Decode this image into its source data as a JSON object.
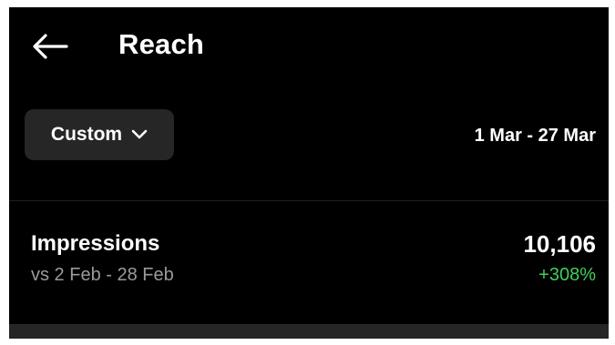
{
  "header": {
    "title": "Reach",
    "back_icon": "arrow-left-icon"
  },
  "filter": {
    "selected": "Custom",
    "dropdown_icon": "chevron-down-icon",
    "date_range": "1 Mar - 27 Mar"
  },
  "metric": {
    "label": "Impressions",
    "comparison": "vs 2 Feb - 28 Feb",
    "value": "10,106",
    "change": "+308%"
  },
  "colors": {
    "background": "#000000",
    "button_bg": "#262626",
    "secondary_text": "#9a9a9a",
    "positive": "#3fcf5b"
  }
}
